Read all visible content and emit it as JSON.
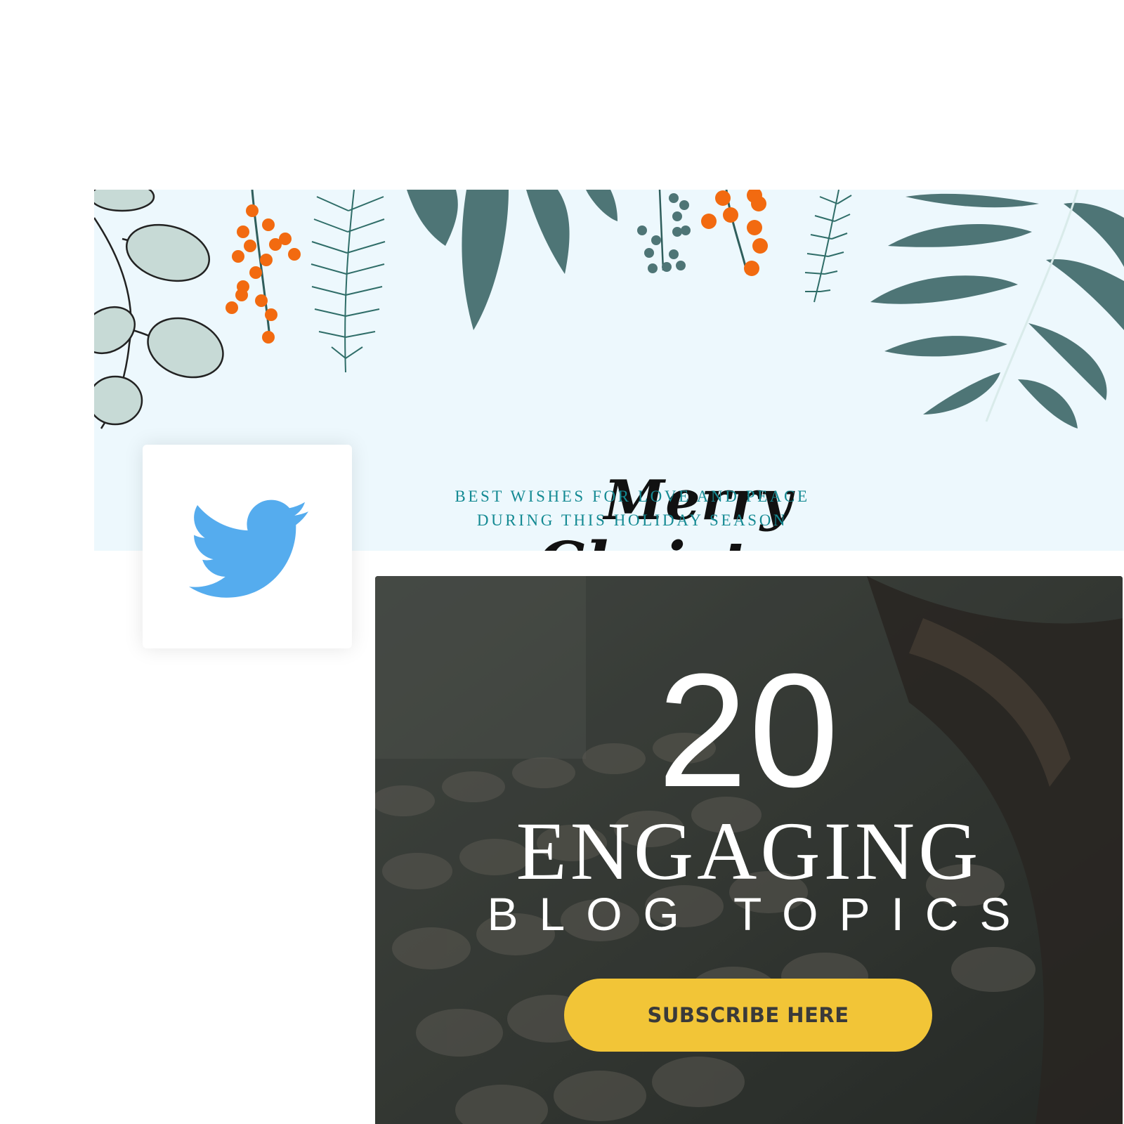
{
  "banner": {
    "greeting_line1": "Merry",
    "greeting_line2": "Christmas",
    "tagline_line1": "BEST WISHES FOR LOVE AND PEACE",
    "tagline_line2": "DURING THIS HOLIDAY SEASON"
  },
  "profile": {
    "icon": "twitter-bird-icon"
  },
  "post": {
    "count": "20",
    "headline": "ENGAGING",
    "subheadline": "BLOG TOPICS",
    "button_label": "SUBSCRIBE HERE"
  },
  "colors": {
    "banner_bg": "#edf8fd",
    "leaf_dark": "#4e7576",
    "berry": "#f26a10",
    "twitter_blue": "#55acee",
    "button": "#f2c537",
    "tagline": "#148a93"
  }
}
